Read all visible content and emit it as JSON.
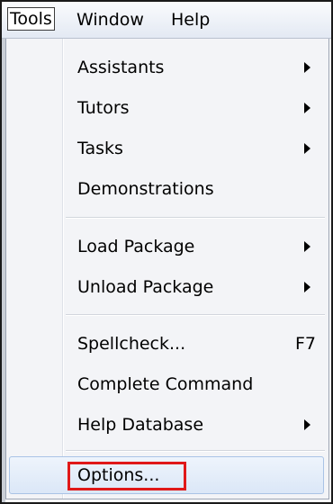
{
  "menubar": {
    "items": [
      "Tools",
      "Window",
      "Help"
    ]
  },
  "menu": {
    "items": [
      {
        "label": "Assistants",
        "submenu": true
      },
      {
        "label": "Tutors",
        "submenu": true
      },
      {
        "label": "Tasks",
        "submenu": true
      },
      {
        "label": "Demonstrations",
        "submenu": false
      },
      {
        "label": "Load Package",
        "submenu": true
      },
      {
        "label": "Unload Package",
        "submenu": true
      },
      {
        "label": "Spellcheck...",
        "shortcut": "F7",
        "submenu": false
      },
      {
        "label": "Complete Command",
        "submenu": false
      },
      {
        "label": "Help Database",
        "submenu": true
      },
      {
        "label": "Options...",
        "submenu": false,
        "highlighted": true
      }
    ]
  },
  "colors": {
    "highlight_border": "#e01818",
    "hover_background": "#dbe7f7"
  }
}
